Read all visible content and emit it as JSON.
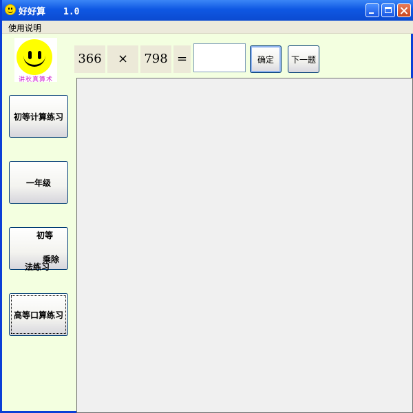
{
  "window": {
    "title": "好好算",
    "version": "1.0"
  },
  "menu": {
    "items": [
      {
        "label": "使用说明"
      }
    ]
  },
  "logo": {
    "caption": "讲秋真算术"
  },
  "sidebar": {
    "buttons": [
      {
        "label": "初等计算练习"
      },
      {
        "label": "一年级"
      },
      {
        "label_parts": [
          "初等",
          "乘除",
          "法练习"
        ]
      },
      {
        "label": "高等口算练习"
      }
    ]
  },
  "question": {
    "operand1": "366",
    "operator": "×",
    "operand2": "798",
    "equals": "="
  },
  "answer": {
    "value": "",
    "placeholder": ""
  },
  "actions": {
    "confirm_label": "确定",
    "next_label": "下一题"
  },
  "colors": {
    "titlebar": "#0b4ad0",
    "background": "#f3ffe0",
    "workspace": "#f0f0f0",
    "smiley": "#ffff00"
  }
}
